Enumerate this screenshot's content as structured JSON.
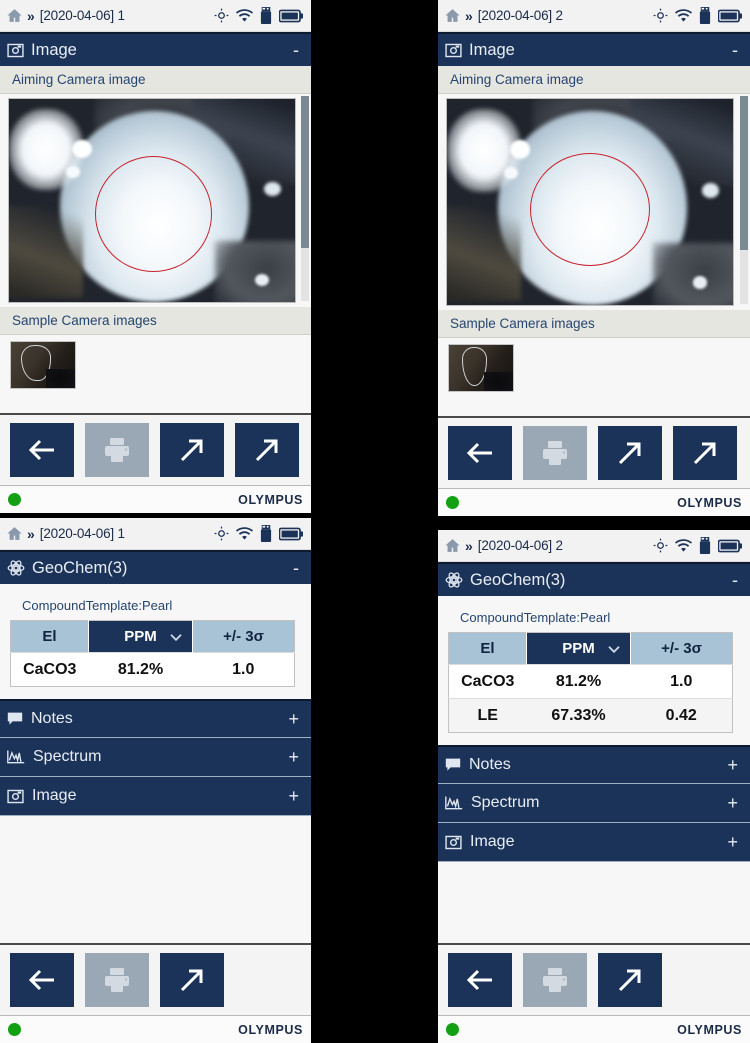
{
  "panels": [
    {
      "id": "left-top",
      "statusbar": {
        "breadcrumb": "[2020-04-06] 1",
        "chevron": "»",
        "icons": [
          "home-icon",
          "target-icon",
          "wifi-icon",
          "usb-icon",
          "battery-icon"
        ]
      },
      "header": {
        "title": "Image",
        "toggle": "-",
        "icon": "image-icon"
      },
      "sections": [
        {
          "label": "Aiming Camera image"
        },
        {
          "label": "Sample Camera images"
        }
      ],
      "buttons": [
        {
          "name": "back-button",
          "icon": "arrow-left-icon",
          "state": "enabled"
        },
        {
          "name": "print-button",
          "icon": "printer-icon",
          "state": "disabled"
        },
        {
          "name": "export-button-1",
          "icon": "arrow-up-right-icon",
          "state": "enabled"
        },
        {
          "name": "export-button-2",
          "icon": "arrow-up-right-icon",
          "state": "enabled"
        }
      ],
      "footer": {
        "brand": "OLYMPUS",
        "status_color": "#13a013"
      }
    },
    {
      "id": "left-bottom",
      "statusbar": {
        "breadcrumb": "[2020-04-06] 1",
        "chevron": "»"
      },
      "header": {
        "title": "GeoChem(3)",
        "toggle": "-",
        "icon": "atom-icon"
      },
      "template_label": "CompoundTemplate:Pearl",
      "table": {
        "columns": [
          "El",
          "PPM",
          "+/- 3σ"
        ],
        "selected_column": "PPM",
        "rows": [
          {
            "el": "CaCO3",
            "ppm": "81.2%",
            "sigma": "1.0"
          }
        ]
      },
      "collapsed": [
        {
          "label": "Notes",
          "toggle": "+",
          "icon": "notes-icon"
        },
        {
          "label": "Spectrum",
          "toggle": "+",
          "icon": "spectrum-icon"
        },
        {
          "label": "Image",
          "toggle": "+",
          "icon": "image-icon"
        }
      ],
      "buttons": [
        {
          "name": "back-button",
          "icon": "arrow-left-icon",
          "state": "enabled"
        },
        {
          "name": "print-button",
          "icon": "printer-icon",
          "state": "disabled"
        },
        {
          "name": "export-button-1",
          "icon": "arrow-up-right-icon",
          "state": "enabled"
        }
      ],
      "footer": {
        "brand": "OLYMPUS",
        "status_color": "#13a013"
      }
    },
    {
      "id": "right-top",
      "statusbar": {
        "breadcrumb": "[2020-04-06] 2",
        "chevron": "»"
      },
      "header": {
        "title": "Image",
        "toggle": "-",
        "icon": "image-icon"
      },
      "sections": [
        {
          "label": "Aiming Camera image"
        },
        {
          "label": "Sample Camera images"
        }
      ],
      "buttons": [
        {
          "name": "back-button",
          "icon": "arrow-left-icon",
          "state": "enabled"
        },
        {
          "name": "print-button",
          "icon": "printer-icon",
          "state": "disabled"
        },
        {
          "name": "export-button-1",
          "icon": "arrow-up-right-icon",
          "state": "enabled"
        },
        {
          "name": "export-button-2",
          "icon": "arrow-up-right-icon",
          "state": "enabled"
        }
      ],
      "footer": {
        "brand": "OLYMPUS",
        "status_color": "#13a013"
      }
    },
    {
      "id": "right-bottom",
      "statusbar": {
        "breadcrumb": "[2020-04-06] 2",
        "chevron": "»"
      },
      "header": {
        "title": "GeoChem(3)",
        "toggle": "-",
        "icon": "atom-icon"
      },
      "template_label": "CompoundTemplate:Pearl",
      "table": {
        "columns": [
          "El",
          "PPM",
          "+/- 3σ"
        ],
        "selected_column": "PPM",
        "rows": [
          {
            "el": "CaCO3",
            "ppm": "81.2%",
            "sigma": "1.0"
          },
          {
            "el": "LE",
            "ppm": "67.33%",
            "sigma": "0.42"
          }
        ]
      },
      "collapsed": [
        {
          "label": "Notes",
          "toggle": "+",
          "icon": "notes-icon"
        },
        {
          "label": "Spectrum",
          "toggle": "+",
          "icon": "spectrum-icon"
        },
        {
          "label": "Image",
          "toggle": "+",
          "icon": "image-icon"
        }
      ],
      "buttons": [
        {
          "name": "back-button",
          "icon": "arrow-left-icon",
          "state": "enabled"
        },
        {
          "name": "print-button",
          "icon": "printer-icon",
          "state": "disabled"
        },
        {
          "name": "export-button-1",
          "icon": "arrow-up-right-icon",
          "state": "enabled"
        }
      ],
      "footer": {
        "brand": "OLYMPUS",
        "status_color": "#13a013"
      }
    }
  ],
  "colors": {
    "header_blue": "#1b3358",
    "table_header_blue": "#a9c3d6",
    "led_green": "#13a013",
    "aim_circle_red": "#c8232c",
    "text_navy": "#25456e"
  }
}
